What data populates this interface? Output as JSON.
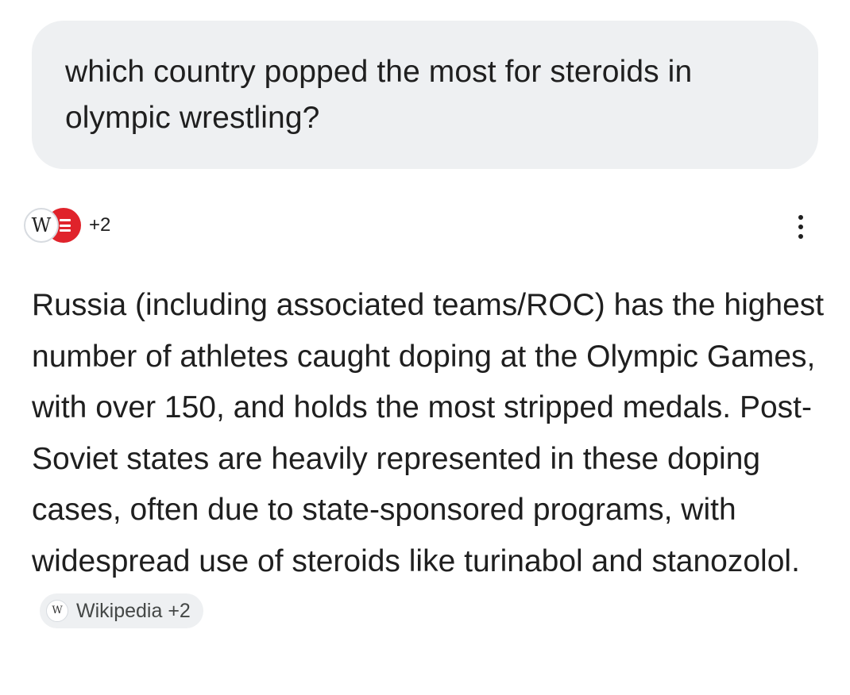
{
  "user_message": {
    "text": "which country popped the most for steroids in olympic wrestling?"
  },
  "sources": {
    "icons": [
      "wikipedia-icon",
      "e-brand-icon"
    ],
    "wikipedia_glyph": "W",
    "count_label": "+2"
  },
  "answer": {
    "text": "Russia (including associated teams/ROC) has the highest number of athletes caught doping at the Olympic Games, with over 150, and holds the most stripped medals. Post-Soviet states are heavily represented in these doping cases, often due to state-sponsored programs, with widespread use of steroids like turinabol and stanozolol.",
    "citation_chip": {
      "icon_glyph": "W",
      "label": "Wikipedia +2"
    }
  },
  "colors": {
    "bubble_background": "#eef0f2",
    "text": "#1f1f1f",
    "brand_red": "#e0232b"
  }
}
